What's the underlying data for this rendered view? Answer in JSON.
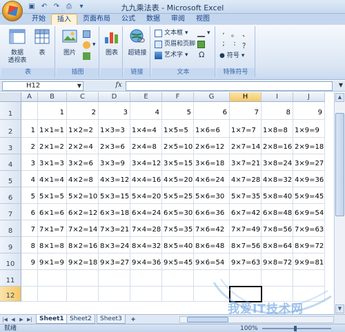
{
  "window": {
    "title": "九九乘法表 - Microsoft Excel"
  },
  "ribbon_tabs": [
    "开始",
    "插入",
    "页面布局",
    "公式",
    "数据",
    "审阅",
    "视图"
  ],
  "ribbon": {
    "groups": [
      {
        "label": "表",
        "pivot": "数据\n透视表",
        "table": "表"
      },
      {
        "label": "插图",
        "picture": "图片"
      },
      {
        "label": "",
        "chart": "图表"
      },
      {
        "label": "链接",
        "hyperlink": "超链接"
      },
      {
        "label": "文本",
        "textbox": "文本框",
        "header_footer": "页眉和页脚",
        "wordart": "艺术字"
      },
      {
        "label": "特殊符号",
        "symbol": "符号",
        "glyphs": [
          ", ",
          "。",
          "、",
          ";",
          ":",
          "？"
        ]
      }
    ],
    "omega": "Ω"
  },
  "formula_bar": {
    "name_box": "H12",
    "fx": "fx",
    "value": ""
  },
  "sheet": {
    "columns": [
      "A",
      "B",
      "C",
      "D",
      "E",
      "F",
      "G",
      "H",
      "I",
      "J"
    ],
    "selected_column": "H",
    "rows": [
      "1",
      "2",
      "3",
      "4",
      "5",
      "6",
      "7",
      "8",
      "9",
      "10",
      "11",
      "12"
    ],
    "selected_row": "12",
    "header_row": [
      "1",
      "2",
      "3",
      "4",
      "5",
      "6",
      "7",
      "8",
      "9"
    ],
    "table": [
      [
        "1",
        "1×1=1",
        "1×2=2",
        "1×3=3",
        "1×4=4",
        "1×5=5",
        "1×6=6",
        "1×7=7",
        "1×8=8",
        "1×9=9"
      ],
      [
        "2",
        "2×1=2",
        "2×2=4",
        "2×3=6",
        "2×4=8",
        "2×5=10",
        "2×6=12",
        "2×7=14",
        "2×8=16",
        "2×9=18"
      ],
      [
        "3",
        "3×1=3",
        "3×2=6",
        "3×3=9",
        "3×4=12",
        "3×5=15",
        "3×6=18",
        "3×7=21",
        "3×8=24",
        "3×9=27"
      ],
      [
        "4",
        "4×1=4",
        "4×2=8",
        "4×3=12",
        "4×4=16",
        "4×5=20",
        "4×6=24",
        "4×7=28",
        "4×8=32",
        "4×9=36"
      ],
      [
        "5",
        "5×1=5",
        "5×2=10",
        "5×3=15",
        "5×4=20",
        "5×5=25",
        "5×6=30",
        "5×7=35",
        "5×8=40",
        "5×9=45"
      ],
      [
        "6",
        "6×1=6",
        "6×2=12",
        "6×3=18",
        "6×4=24",
        "6×5=30",
        "6×6=36",
        "6×7=42",
        "6×8=48",
        "6×9=54"
      ],
      [
        "7",
        "7×1=7",
        "7×2=14",
        "7×3=21",
        "7×4=28",
        "7×5=35",
        "7×6=42",
        "7×7=49",
        "7×8=56",
        "7×9=63"
      ],
      [
        "8",
        "8×1=8",
        "8×2=16",
        "8×3=24",
        "8×4=32",
        "8×5=40",
        "8×6=48",
        "8×7=56",
        "8×8=64",
        "8×9=72"
      ],
      [
        "9",
        "9×1=9",
        "9×2=18",
        "9×3=27",
        "9×4=36",
        "9×5=45",
        "9×6=54",
        "9×7=63",
        "9×8=72",
        "9×9=81"
      ]
    ]
  },
  "sheet_tabs": [
    "Sheet1",
    "Sheet2",
    "Sheet3"
  ],
  "active_sheet": "Sheet1",
  "status": {
    "ready": "就绪",
    "zoom": "100%"
  },
  "watermark": "我爱IT技术网",
  "colors": {
    "accent": "#15428b",
    "selected_header": "#f6c865",
    "ribbon_bg": "#dbe6f4"
  }
}
